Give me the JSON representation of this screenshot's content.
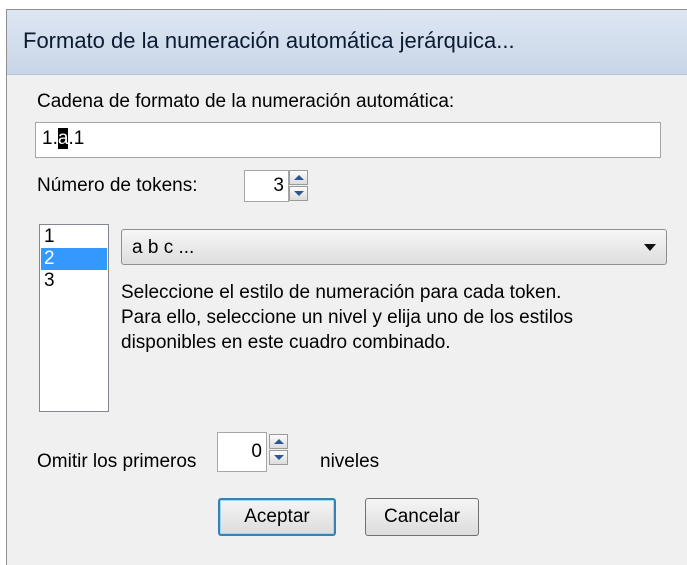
{
  "window": {
    "title": "Formato de la numeración automática jerárquica..."
  },
  "format_string": {
    "label": "Cadena de formato de la numeración automática:",
    "value_before": "1.",
    "value_selected": "a",
    "value_after": ".1"
  },
  "tokens": {
    "label": "Número de tokens:",
    "value": "3"
  },
  "levels": {
    "items": [
      {
        "label": "1",
        "selected": false
      },
      {
        "label": "2",
        "selected": true
      },
      {
        "label": "3",
        "selected": false
      }
    ]
  },
  "style_combo": {
    "value": "a b c ..."
  },
  "help_text": {
    "line1": "Seleccione el estilo de numeración para cada token.",
    "line2": "Para ello, seleccione un nivel y elija uno de los estilos",
    "line3": "disponibles en este cuadro combinado."
  },
  "skip": {
    "label_before": "Omitir los primeros",
    "value": "0",
    "label_after": "niveles"
  },
  "buttons": {
    "ok": "Aceptar",
    "cancel": "Cancelar"
  },
  "colors": {
    "selection": "#3399ff",
    "titlebar": "#c9d6e8",
    "dialog_bg": "#f0f0f0"
  }
}
